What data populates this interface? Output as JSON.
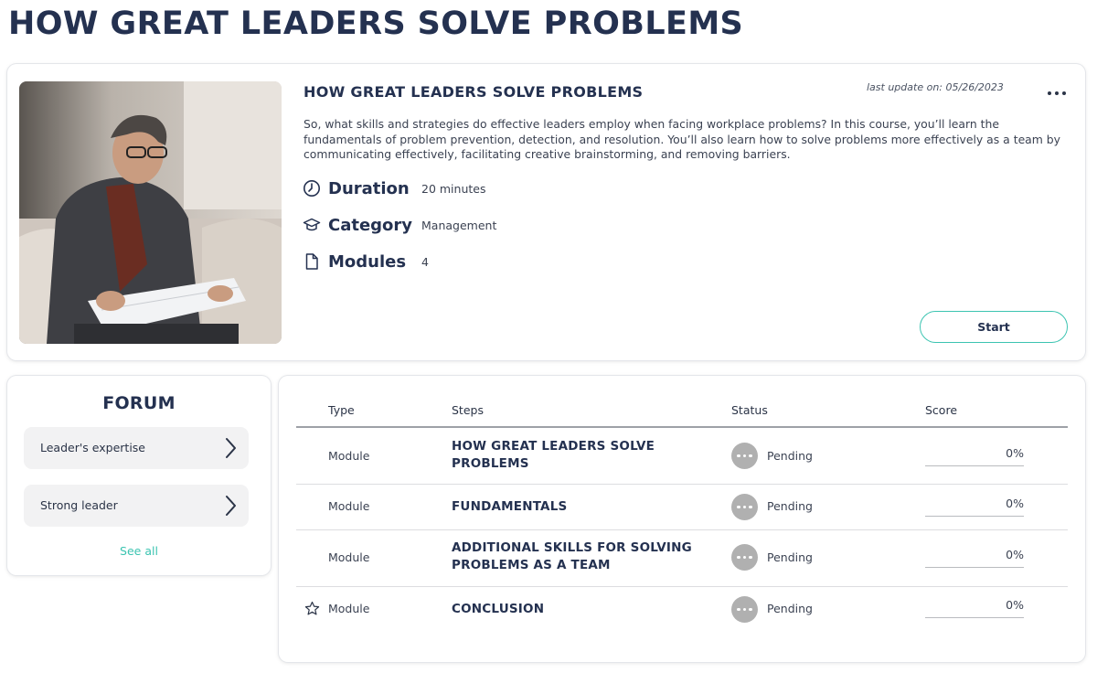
{
  "page": {
    "title": "HOW GREAT LEADERS SOLVE PROBLEMS"
  },
  "course": {
    "image_alt": "man in glasses reading documents on a sofa",
    "title": "HOW GREAT LEADERS SOLVE PROBLEMS",
    "last_update": "last update on: 05/26/2023",
    "description": "So, what skills and strategies do effective leaders employ when facing workplace problems? In this course, you’ll learn the fundamentals of problem prevention, detection, and resolution. You’ll also learn how to solve problems more effectively as a team by communicating effectively, facilitating creative brainstorming, and removing barriers.",
    "meta": [
      {
        "icon": "clock-icon",
        "label": "Duration",
        "value": "20 minutes"
      },
      {
        "icon": "graduation-cap-icon",
        "label": "Category",
        "value": "Management"
      },
      {
        "icon": "document-icon",
        "label": "Modules",
        "value": "4"
      }
    ],
    "start_label": "Start"
  },
  "forum": {
    "title": "FORUM",
    "items": [
      {
        "label": "Leader's expertise"
      },
      {
        "label": "Strong leader"
      }
    ],
    "see_all": "See all"
  },
  "steps_table": {
    "headers": {
      "type": "Type",
      "steps": "Steps",
      "status": "Status",
      "score": "Score"
    },
    "rows": [
      {
        "type": "Module",
        "step": "HOW GREAT LEADERS SOLVE PROBLEMS",
        "status": "Pending",
        "score": "0%",
        "starred": false
      },
      {
        "type": "Module",
        "step": "FUNDAMENTALS",
        "status": "Pending",
        "score": "0%",
        "starred": false
      },
      {
        "type": "Module",
        "step": "ADDITIONAL SKILLS FOR SOLVING PROBLEMS AS A TEAM",
        "status": "Pending",
        "score": "0%",
        "starred": false
      },
      {
        "type": "Module",
        "step": "CONCLUSION",
        "status": "Pending",
        "score": "0%",
        "starred": true
      }
    ]
  },
  "colors": {
    "title": "#243150",
    "accent": "#3cc4b1",
    "status_dot": "#b0b0b0"
  }
}
